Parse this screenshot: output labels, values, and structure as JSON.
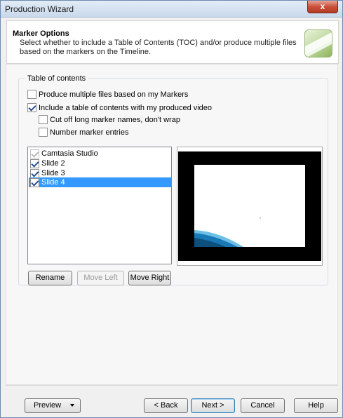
{
  "window": {
    "title": "Production Wizard",
    "close_glyph": "x"
  },
  "header": {
    "title": "Marker Options",
    "description": "Select whether to include a Table of Contents (TOC) and/or produce multiple files based on the markers on the Timeline.",
    "logo_icon": "camtasia-logo-icon"
  },
  "toc_group": {
    "legend": "Table of contents",
    "options": [
      {
        "label": "Produce multiple files based on my Markers",
        "checked": false
      },
      {
        "label": "Include a table of contents with my produced video",
        "checked": true
      },
      {
        "label": "Cut off long marker names, don't wrap",
        "checked": false
      },
      {
        "label": "Number marker entries",
        "checked": false
      }
    ]
  },
  "markers": [
    {
      "label": "Camtasia Studio",
      "checked": true,
      "disabled": true,
      "selected": false
    },
    {
      "label": "Slide 2",
      "checked": true,
      "disabled": false,
      "selected": false
    },
    {
      "label": "Slide 3",
      "checked": true,
      "disabled": false,
      "selected": false
    },
    {
      "label": "Slide 4",
      "checked": true,
      "disabled": false,
      "selected": true
    }
  ],
  "marker_buttons": {
    "rename": "Rename",
    "move_left": "Move Left",
    "move_right": "Move Right"
  },
  "footer": {
    "preview": "Preview",
    "back": "< Back",
    "next": "Next >",
    "cancel": "Cancel",
    "help": "Help"
  },
  "colors": {
    "selection": "#3399ff",
    "preview_background": "#000000",
    "accent_blue": "#1a7ab8"
  }
}
